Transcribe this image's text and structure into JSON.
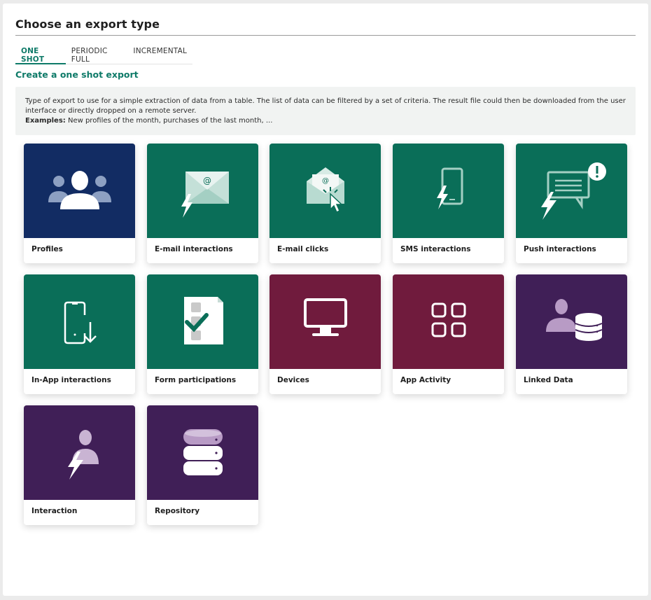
{
  "header": {
    "title": "Choose an export type"
  },
  "tabs": [
    {
      "label": "ONE SHOT",
      "active": true
    },
    {
      "label": "PERIODIC FULL",
      "active": false
    },
    {
      "label": "INCREMENTAL",
      "active": false
    }
  ],
  "section": {
    "subtitle": "Create a one shot export",
    "description": "Type of export to use for a simple extraction of data from a table. The list of data can be filtered by a set of criteria. The result file could then be downloaded from the user interface or directly dropped on a remote server.",
    "examples_label": "Examples:",
    "examples_text": " New profiles of the month, purchases of the last month, ..."
  },
  "colors": {
    "accent": "#0e7a68",
    "navy": "#122c63",
    "green": "#0a6e58",
    "wine": "#701b3d",
    "purple": "#401f57"
  },
  "cards": [
    {
      "label": "Profiles",
      "icon": "profiles-icon",
      "color": "navy"
    },
    {
      "label": "E-mail interactions",
      "icon": "email-interactions-icon",
      "color": "green"
    },
    {
      "label": "E-mail clicks",
      "icon": "email-clicks-icon",
      "color": "green"
    },
    {
      "label": "SMS interactions",
      "icon": "sms-icon",
      "color": "green"
    },
    {
      "label": "Push interactions",
      "icon": "push-icon",
      "color": "green"
    },
    {
      "label": "In-App interactions",
      "icon": "in-app-icon",
      "color": "green"
    },
    {
      "label": "Form participations",
      "icon": "form-icon",
      "color": "green"
    },
    {
      "label": "Devices",
      "icon": "monitor-icon",
      "color": "wine"
    },
    {
      "label": "App Activity",
      "icon": "app-grid-icon",
      "color": "wine"
    },
    {
      "label": "Linked Data",
      "icon": "linked-data-icon",
      "color": "purple"
    },
    {
      "label": "Interaction",
      "icon": "interaction-icon",
      "color": "purple"
    },
    {
      "label": "Repository",
      "icon": "database-icon",
      "color": "purple"
    }
  ]
}
